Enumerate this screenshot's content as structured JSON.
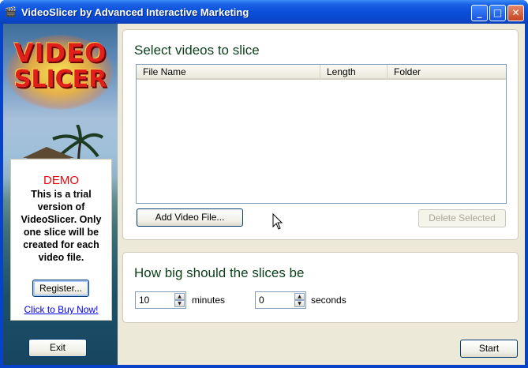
{
  "window": {
    "title": "VideoSlicer by Advanced Interactive Marketing",
    "icon": "film-clapper-icon",
    "controls": {
      "minimize": "minimize-icon",
      "maximize": "maximize-icon",
      "close": "close-icon"
    }
  },
  "sidebar": {
    "logo_line1": "VIDEO",
    "logo_line2": "SLICER",
    "demo": {
      "title": "DEMO",
      "text": "This is a trial version of VideoSlicer. Only one slice will be created for each video file.",
      "register_label": "Register...",
      "buy_link": "Click to Buy Now!"
    },
    "exit_label": "Exit"
  },
  "select_group": {
    "title": "Select videos to slice",
    "columns": [
      "File Name",
      "Length",
      "Folder"
    ],
    "rows": [],
    "add_label": "Add Video File...",
    "delete_label": "Delete Selected"
  },
  "slice_group": {
    "title": "How big should the slices be",
    "minutes_value": "10",
    "minutes_label": "minutes",
    "seconds_value": "0",
    "seconds_label": "seconds"
  },
  "start_label": "Start",
  "colors": {
    "titlebar": "#0b4fd8",
    "demo_red": "#e8070e",
    "group_title": "#0a3f1a",
    "link": "#0000ee",
    "client_bg": "#ece9d8"
  }
}
